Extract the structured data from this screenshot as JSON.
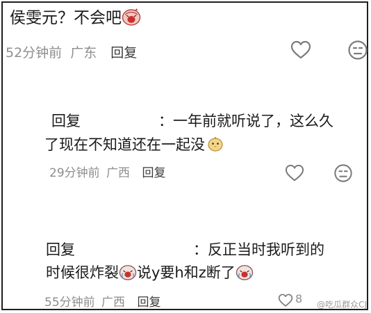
{
  "comments": [
    {
      "line1": "侯雯元？不会吧",
      "time": "52分钟前",
      "location": "广东",
      "reply_label": "回复"
    },
    {
      "prefix": "回复",
      "line1": "：一年前就听说了，这么久",
      "line2": "了现在不知道还在一起没",
      "time": "29分钟前",
      "location": "广西",
      "reply_label": "回复"
    },
    {
      "prefix": "回复",
      "line1": "：反正当时我听到的",
      "line2a": "时候很炸裂",
      "line2b": "说y要h和z断了",
      "time": "55分钟前",
      "location": "广西",
      "reply_label": "回复",
      "like_count": "8"
    }
  ],
  "watermark": "@吃瓜群众CJ",
  "icons": {
    "like": "heart-outline-icon",
    "dislike": "neutral-face-icon",
    "emoji_cry": "crying-face-emoji",
    "emoji_chick": "chick-emoji"
  }
}
